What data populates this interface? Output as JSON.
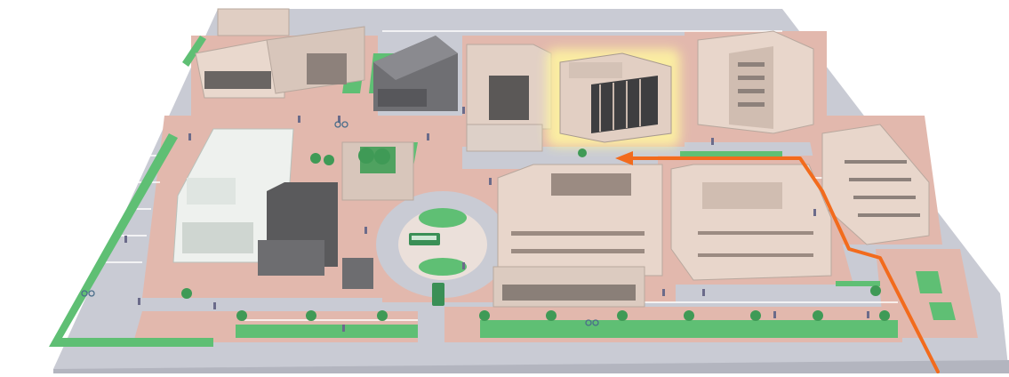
{
  "map": {
    "kind": "isometric campus map",
    "highlighted_building": "highlighted-target-building",
    "route": {
      "color": "#f26b1d",
      "arrow": "arrow-left-icon"
    },
    "colors": {
      "ground": "#c9cbd4",
      "sidewalk": "#e2b8ad",
      "grass": "#5fbf74",
      "building_light": "#e9d8cd",
      "building_dark": "#5a5a5c",
      "highlight_glow": "#fff7a0"
    },
    "icons": [
      "tree-icon",
      "bus-icon",
      "car-icon",
      "bicycle-icon",
      "pedestrian-icon"
    ]
  }
}
